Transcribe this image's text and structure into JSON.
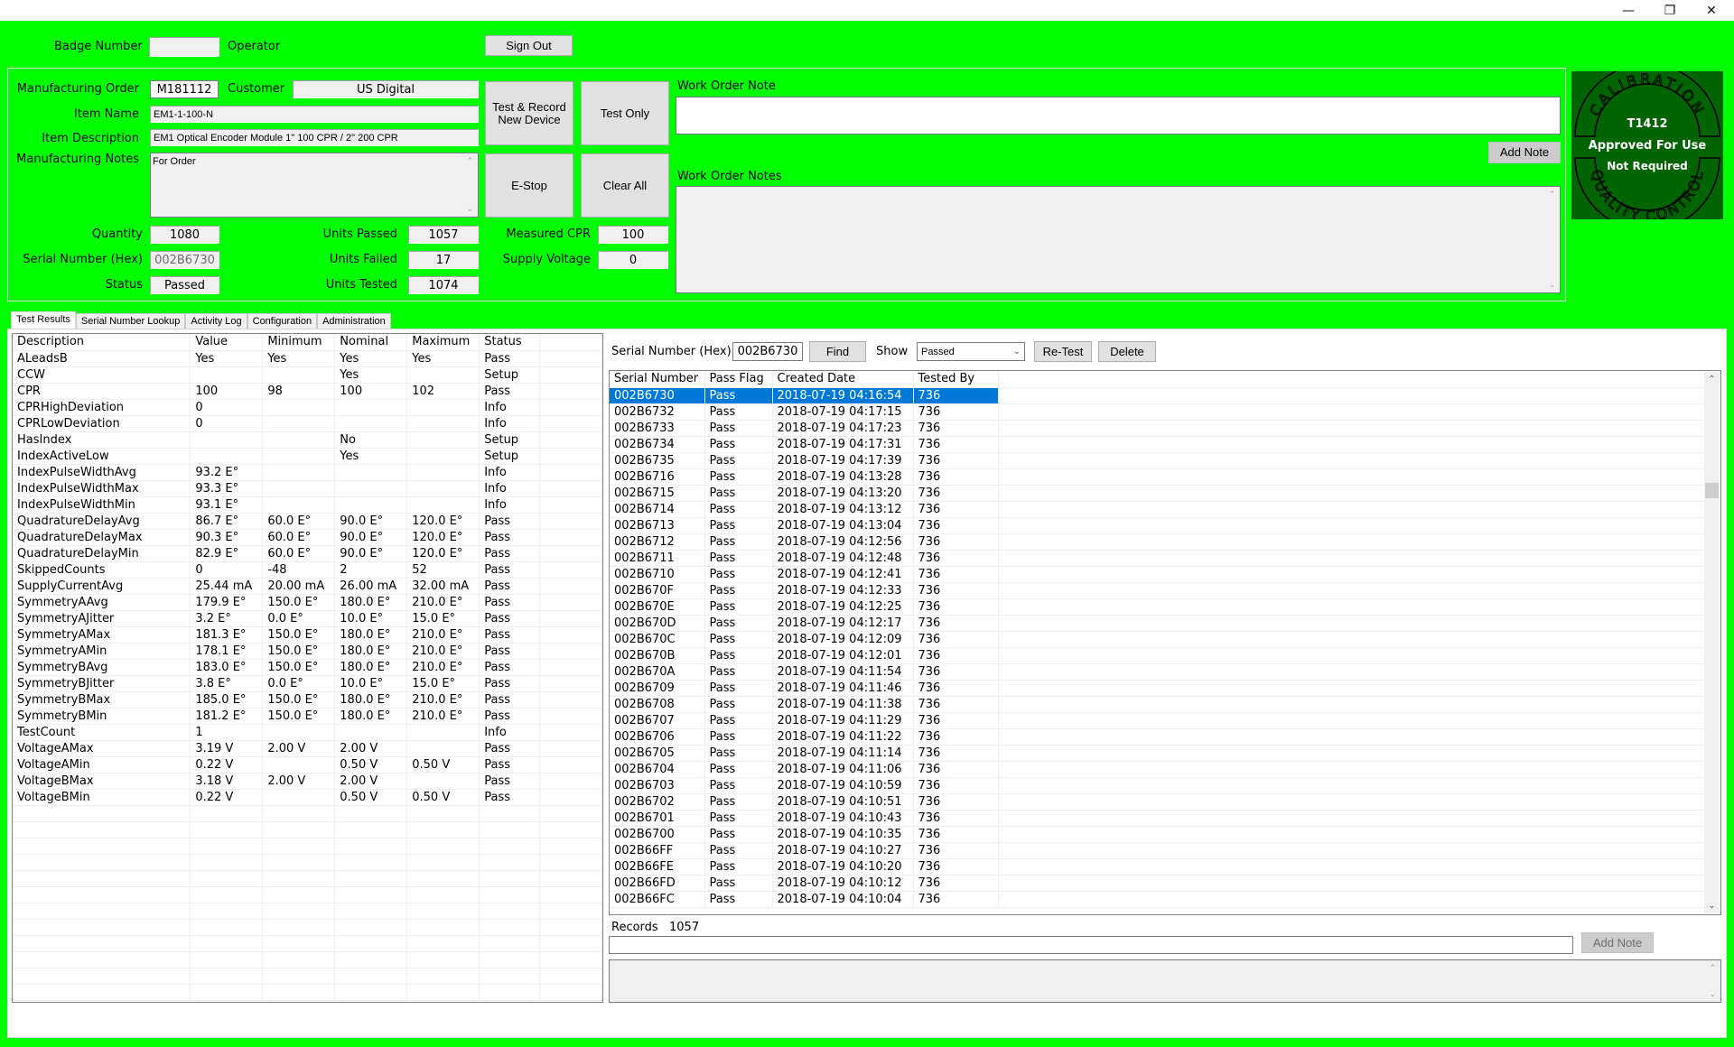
{
  "window": {
    "controls": {
      "minimize": "—",
      "restore": "❐",
      "close": "✕"
    }
  },
  "header": {
    "badge_label": "Badge Number",
    "badge_value": "",
    "operator_label": "Operator",
    "sign_out": "Sign Out"
  },
  "order": {
    "mo_label": "Manufacturing Order",
    "mo_value": "M181112",
    "customer_label": "Customer",
    "customer_value": "US Digital",
    "item_name_label": "Item Name",
    "item_name_value": "EM1-1-100-N",
    "item_desc_label": "Item Description",
    "item_desc_value": "EM1 Optical Encoder Module 1\" 100 CPR / 2\" 200 CPR",
    "mfg_notes_label": "Manufacturing Notes",
    "mfg_notes_value": "For Order",
    "quantity_label": "Quantity",
    "quantity_value": "1080",
    "serial_label": "Serial Number (Hex)",
    "serial_value": "002B6730",
    "status_label": "Status",
    "status_value": "Passed",
    "units_passed_label": "Units Passed",
    "units_passed_value": "1057",
    "units_failed_label": "Units Failed",
    "units_failed_value": "17",
    "units_tested_label": "Units Tested",
    "units_tested_value": "1074",
    "measured_cpr_label": "Measured CPR",
    "measured_cpr_value": "100",
    "supply_voltage_label": "Supply Voltage",
    "supply_voltage_value": "0"
  },
  "actions": {
    "test_record": "Test & Record New Device",
    "test_only": "Test Only",
    "estop": "E-Stop",
    "clear_all": "Clear All"
  },
  "notes": {
    "work_order_note_label": "Work Order Note",
    "work_order_note_value": "",
    "add_note": "Add Note",
    "work_order_notes_label": "Work Order Notes",
    "work_order_notes_value": ""
  },
  "calibration": {
    "top_arc": "CALIBRATION",
    "bottom_arc": "QUALITY CONTROL",
    "id": "T1412",
    "line1": "Approved For Use",
    "line2": "Not Required",
    "color": "#006400"
  },
  "tabs": [
    {
      "label": "Test Results",
      "active": true
    },
    {
      "label": "Serial Number Lookup",
      "active": false
    },
    {
      "label": "Activity Log",
      "active": false
    },
    {
      "label": "Configuration",
      "active": false
    },
    {
      "label": "Administration",
      "active": false
    }
  ],
  "results": {
    "columns": [
      "Description",
      "Value",
      "Minimum",
      "Nominal",
      "Maximum",
      "Status"
    ],
    "rows": [
      [
        "ALeadsB",
        "Yes",
        "Yes",
        "Yes",
        "Yes",
        "Pass"
      ],
      [
        "CCW",
        "",
        "",
        "Yes",
        "",
        "Setup"
      ],
      [
        "CPR",
        "100",
        "98",
        "100",
        "102",
        "Pass"
      ],
      [
        "CPRHighDeviation",
        "0",
        "",
        "",
        "",
        "Info"
      ],
      [
        "CPRLowDeviation",
        "0",
        "",
        "",
        "",
        "Info"
      ],
      [
        "HasIndex",
        "",
        "",
        "No",
        "",
        "Setup"
      ],
      [
        "IndexActiveLow",
        "",
        "",
        "Yes",
        "",
        "Setup"
      ],
      [
        "IndexPulseWidthAvg",
        "93.2 E°",
        "",
        "",
        "",
        "Info"
      ],
      [
        "IndexPulseWidthMax",
        "93.3 E°",
        "",
        "",
        "",
        "Info"
      ],
      [
        "IndexPulseWidthMin",
        "93.1 E°",
        "",
        "",
        "",
        "Info"
      ],
      [
        "QuadratureDelayAvg",
        "86.7 E°",
        "60.0 E°",
        "90.0 E°",
        "120.0 E°",
        "Pass"
      ],
      [
        "QuadratureDelayMax",
        "90.3 E°",
        "60.0 E°",
        "90.0 E°",
        "120.0 E°",
        "Pass"
      ],
      [
        "QuadratureDelayMin",
        "82.9 E°",
        "60.0 E°",
        "90.0 E°",
        "120.0 E°",
        "Pass"
      ],
      [
        "SkippedCounts",
        "0",
        "-48",
        "2",
        "52",
        "Pass"
      ],
      [
        "SupplyCurrentAvg",
        "25.44 mA",
        "20.00 mA",
        "26.00 mA",
        "32.00 mA",
        "Pass"
      ],
      [
        "SymmetryAAvg",
        "179.9 E°",
        "150.0 E°",
        "180.0 E°",
        "210.0 E°",
        "Pass"
      ],
      [
        "SymmetryAJitter",
        "3.2 E°",
        "0.0 E°",
        "10.0 E°",
        "15.0 E°",
        "Pass"
      ],
      [
        "SymmetryAMax",
        "181.3 E°",
        "150.0 E°",
        "180.0 E°",
        "210.0 E°",
        "Pass"
      ],
      [
        "SymmetryAMin",
        "178.1 E°",
        "150.0 E°",
        "180.0 E°",
        "210.0 E°",
        "Pass"
      ],
      [
        "SymmetryBAvg",
        "183.0 E°",
        "150.0 E°",
        "180.0 E°",
        "210.0 E°",
        "Pass"
      ],
      [
        "SymmetryBJitter",
        "3.8 E°",
        "0.0 E°",
        "10.0 E°",
        "15.0 E°",
        "Pass"
      ],
      [
        "SymmetryBMax",
        "185.0 E°",
        "150.0 E°",
        "180.0 E°",
        "210.0 E°",
        "Pass"
      ],
      [
        "SymmetryBMin",
        "181.2 E°",
        "150.0 E°",
        "180.0 E°",
        "210.0 E°",
        "Pass"
      ],
      [
        "TestCount",
        "1",
        "",
        "",
        "",
        "Info"
      ],
      [
        "VoltageAMax",
        "3.19 V",
        "2.00 V",
        "2.00 V",
        "",
        "Pass"
      ],
      [
        "VoltageAMin",
        "0.22 V",
        "",
        "0.50 V",
        "0.50 V",
        "Pass"
      ],
      [
        "VoltageBMax",
        "3.18 V",
        "2.00 V",
        "2.00 V",
        "",
        "Pass"
      ],
      [
        "VoltageBMin",
        "0.22 V",
        "",
        "0.50 V",
        "0.50 V",
        "Pass"
      ]
    ]
  },
  "lookup": {
    "serial_label": "Serial Number (Hex)",
    "serial_value": "002B6730",
    "find": "Find",
    "show_label": "Show",
    "show_value": "Passed",
    "retest": "Re-Test",
    "delete": "Delete",
    "columns": [
      "Serial Number",
      "Pass Flag",
      "Created Date",
      "Tested By"
    ],
    "selected_index": 0,
    "rows": [
      [
        "002B6730",
        "Pass",
        "2018-07-19 04:16:54",
        "736"
      ],
      [
        "002B6732",
        "Pass",
        "2018-07-19 04:17:15",
        "736"
      ],
      [
        "002B6733",
        "Pass",
        "2018-07-19 04:17:23",
        "736"
      ],
      [
        "002B6734",
        "Pass",
        "2018-07-19 04:17:31",
        "736"
      ],
      [
        "002B6735",
        "Pass",
        "2018-07-19 04:17:39",
        "736"
      ],
      [
        "002B6716",
        "Pass",
        "2018-07-19 04:13:28",
        "736"
      ],
      [
        "002B6715",
        "Pass",
        "2018-07-19 04:13:20",
        "736"
      ],
      [
        "002B6714",
        "Pass",
        "2018-07-19 04:13:12",
        "736"
      ],
      [
        "002B6713",
        "Pass",
        "2018-07-19 04:13:04",
        "736"
      ],
      [
        "002B6712",
        "Pass",
        "2018-07-19 04:12:56",
        "736"
      ],
      [
        "002B6711",
        "Pass",
        "2018-07-19 04:12:48",
        "736"
      ],
      [
        "002B6710",
        "Pass",
        "2018-07-19 04:12:41",
        "736"
      ],
      [
        "002B670F",
        "Pass",
        "2018-07-19 04:12:33",
        "736"
      ],
      [
        "002B670E",
        "Pass",
        "2018-07-19 04:12:25",
        "736"
      ],
      [
        "002B670D",
        "Pass",
        "2018-07-19 04:12:17",
        "736"
      ],
      [
        "002B670C",
        "Pass",
        "2018-07-19 04:12:09",
        "736"
      ],
      [
        "002B670B",
        "Pass",
        "2018-07-19 04:12:01",
        "736"
      ],
      [
        "002B670A",
        "Pass",
        "2018-07-19 04:11:54",
        "736"
      ],
      [
        "002B6709",
        "Pass",
        "2018-07-19 04:11:46",
        "736"
      ],
      [
        "002B6708",
        "Pass",
        "2018-07-19 04:11:38",
        "736"
      ],
      [
        "002B6707",
        "Pass",
        "2018-07-19 04:11:29",
        "736"
      ],
      [
        "002B6706",
        "Pass",
        "2018-07-19 04:11:22",
        "736"
      ],
      [
        "002B6705",
        "Pass",
        "2018-07-19 04:11:14",
        "736"
      ],
      [
        "002B6704",
        "Pass",
        "2018-07-19 04:11:06",
        "736"
      ],
      [
        "002B6703",
        "Pass",
        "2018-07-19 04:10:59",
        "736"
      ],
      [
        "002B6702",
        "Pass",
        "2018-07-19 04:10:51",
        "736"
      ],
      [
        "002B6701",
        "Pass",
        "2018-07-19 04:10:43",
        "736"
      ],
      [
        "002B6700",
        "Pass",
        "2018-07-19 04:10:35",
        "736"
      ],
      [
        "002B66FF",
        "Pass",
        "2018-07-19 04:10:27",
        "736"
      ],
      [
        "002B66FE",
        "Pass",
        "2018-07-19 04:10:20",
        "736"
      ],
      [
        "002B66FD",
        "Pass",
        "2018-07-19 04:10:12",
        "736"
      ],
      [
        "002B66FC",
        "Pass",
        "2018-07-19 04:10:04",
        "736"
      ]
    ],
    "records_label": "Records",
    "records_value": "1057",
    "note_value": "",
    "add_note": "Add Note",
    "notes_value": ""
  },
  "theme": {
    "background": "#00ff00",
    "selection": "#0078d7"
  }
}
